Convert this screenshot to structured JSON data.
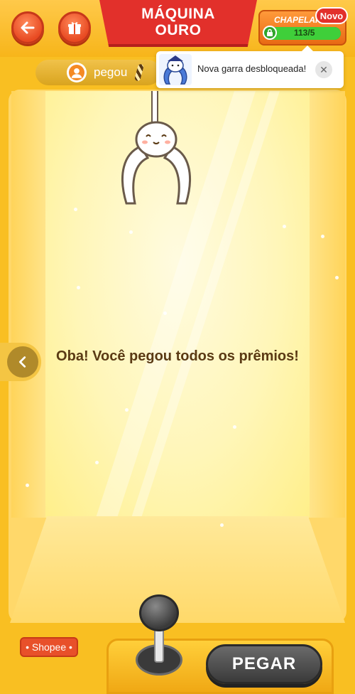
{
  "header": {
    "title_line1": "MÁQUINA",
    "title_line2": "OURO",
    "claw_name": "CHAPELAR",
    "new_badge": "Novo",
    "progress_text": "113/5",
    "progress_fraction": 1.0
  },
  "player": {
    "name": "pegou"
  },
  "toast": {
    "message": "Nova garra desbloqueada!",
    "close_icon": "close-icon"
  },
  "main": {
    "message": "Oba! Você pegou todos os prêmios!"
  },
  "controls": {
    "grab_label": "PEGAR",
    "shopee_label": "• Shopee •"
  },
  "colors": {
    "accent_red": "#e2302b",
    "machine_yellow": "#f9bf22",
    "button_dark": "#3a3a3a"
  }
}
